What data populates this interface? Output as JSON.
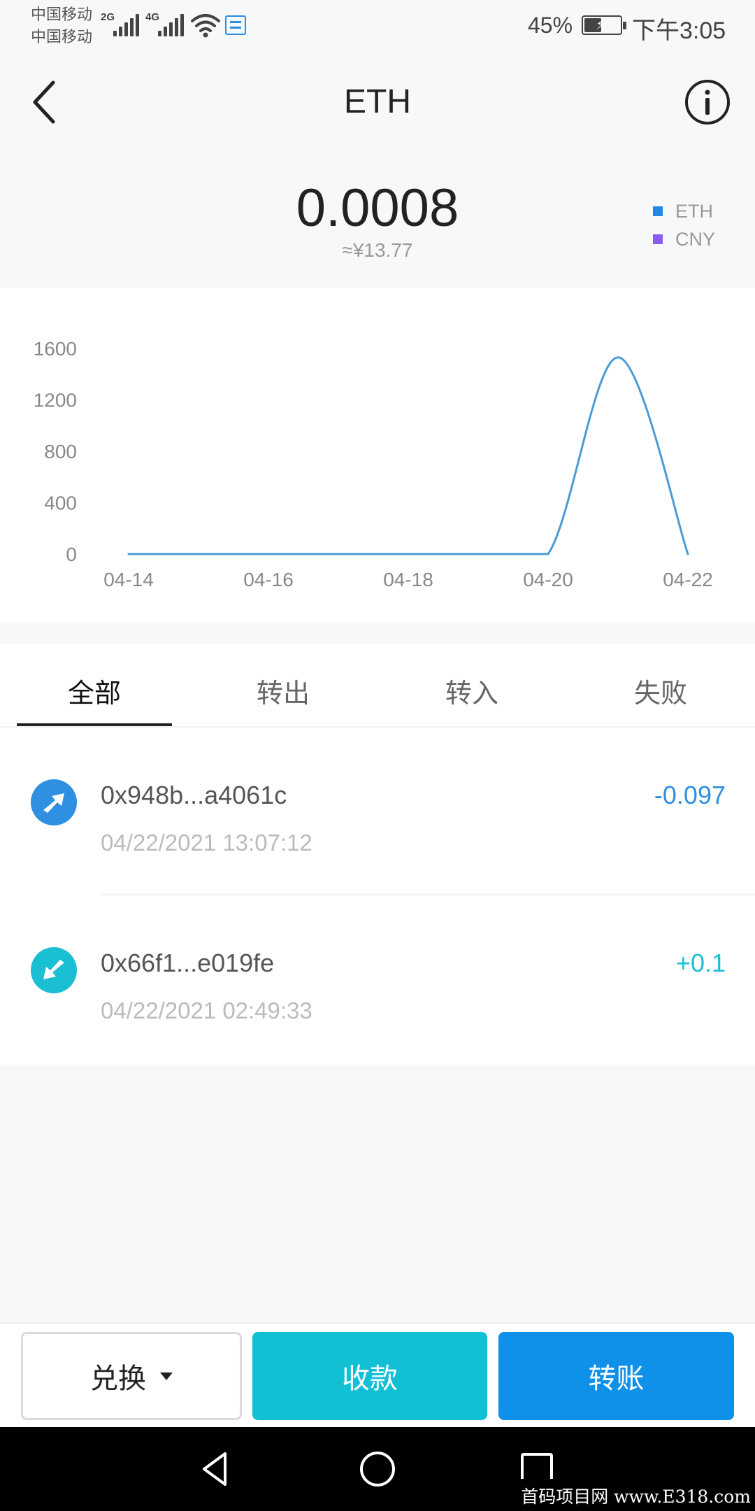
{
  "status_bar": {
    "carrier_1": "中国移动",
    "carrier_2": "中国移动",
    "net_1": "2G",
    "net_2": "4G",
    "battery_percent": "45%",
    "battery_level": 0.45,
    "time": "下午3:05",
    "icons": [
      "signal-icon",
      "wifi-icon",
      "notification-icon",
      "battery-charging-icon"
    ]
  },
  "header": {
    "title": "ETH",
    "back_icon": "chevron-left-icon",
    "info_icon": "info-icon"
  },
  "balance": {
    "amount": "0.0008",
    "fiat": "≈¥13.77"
  },
  "legend": [
    {
      "label": "ETH",
      "color": "#1e88e5"
    },
    {
      "label": "CNY",
      "color": "#8a5cf0"
    }
  ],
  "chart_data": {
    "type": "line",
    "x": [
      "04-14",
      "04-15",
      "04-16",
      "04-17",
      "04-18",
      "04-19",
      "04-20",
      "04-21",
      "04-22"
    ],
    "series": [
      {
        "values": [
          0,
          0,
          0,
          0,
          0,
          0,
          0,
          1530,
          0
        ],
        "color": "#4a9bd6"
      }
    ],
    "xticks": [
      "04-14",
      "04-16",
      "04-18",
      "04-20",
      "04-22"
    ],
    "yticks": [
      "0",
      "400",
      "800",
      "1200",
      "1600"
    ],
    "ylim": [
      0,
      1600
    ],
    "grid": false,
    "legend_placement": "top-right"
  },
  "tabs": [
    {
      "label": "全部",
      "active": true
    },
    {
      "label": "转出",
      "active": false
    },
    {
      "label": "转入",
      "active": false
    },
    {
      "label": "失败",
      "active": false
    }
  ],
  "transactions": [
    {
      "address": "0x948b...a4061c",
      "time": "04/22/2021 13:07:12",
      "amount": "-0.097",
      "direction": "out",
      "icon": "send-arrow-icon",
      "color": "#2f8fe0"
    },
    {
      "address": "0x66f1...e019fe",
      "time": "04/22/2021 02:49:33",
      "amount": "+0.1",
      "direction": "in",
      "icon": "receive-arrow-icon",
      "color": "#1bbfd3"
    }
  ],
  "actions": {
    "exchange": "兑换",
    "receive": "收款",
    "transfer": "转账"
  },
  "nav": {
    "icons": [
      "nav-back-icon",
      "nav-home-icon",
      "nav-recent-icon"
    ]
  },
  "watermark": "首码项目网 www.E318.com"
}
